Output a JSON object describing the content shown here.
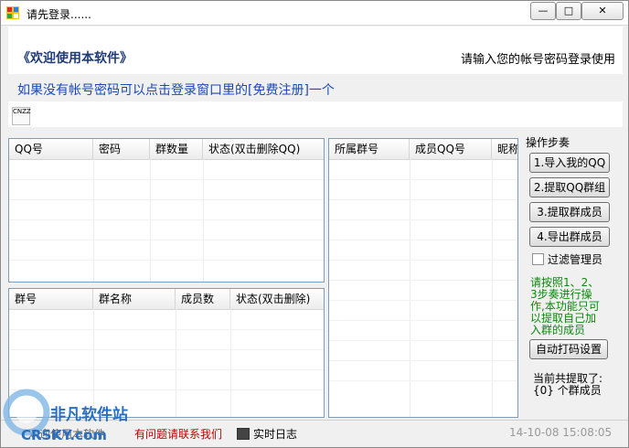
{
  "window": {
    "title": "请先登录......"
  },
  "controls": {
    "minimize": "—",
    "maximize": "□",
    "close": "✕"
  },
  "header": {
    "welcome": "《欢迎使用本软件》",
    "login_prompt": "请输入您的帐号密码登录使用",
    "notice": "如果没有帐号密码可以点击登录窗口里的[免费注册]一个",
    "badge": "CNZZ"
  },
  "accounts_table": {
    "columns": [
      "QQ号",
      "密码",
      "群数量",
      "状态(双击删除QQ)"
    ]
  },
  "groups_table": {
    "columns": [
      "群号",
      "群名称",
      "成员数",
      "状态(双击删除)"
    ]
  },
  "members_table": {
    "columns": [
      "所属群号",
      "成员QQ号",
      "昵称"
    ]
  },
  "steps": {
    "title": "操作步奏",
    "buttons": [
      "1.导入我的QQ",
      "2.提取QQ群组",
      "3.提取群成员",
      "4.导出群成员"
    ],
    "filter_label": "过滤管理员",
    "filter_checked": false,
    "help": "请按照1、2、3步奏进行操作,本功能只可以提取自己加入群的成员",
    "captcha_button": "自动打码设置",
    "count_label": "当前共提取了:",
    "count_value": "{0} 个群成员"
  },
  "statusbar": {
    "left": "欢迎使用本软件",
    "contact": "有问题请联系我们",
    "log": "实时日志",
    "timestamp": "14-10-08 15:08:05"
  },
  "watermark": {
    "brand": "非凡软件站",
    "domain": "CRSKY.com"
  },
  "colors": {
    "welcome": "#1f3b78",
    "notice": "#1b49b5",
    "help": "#0a8a0a",
    "contact": "#c00000"
  }
}
